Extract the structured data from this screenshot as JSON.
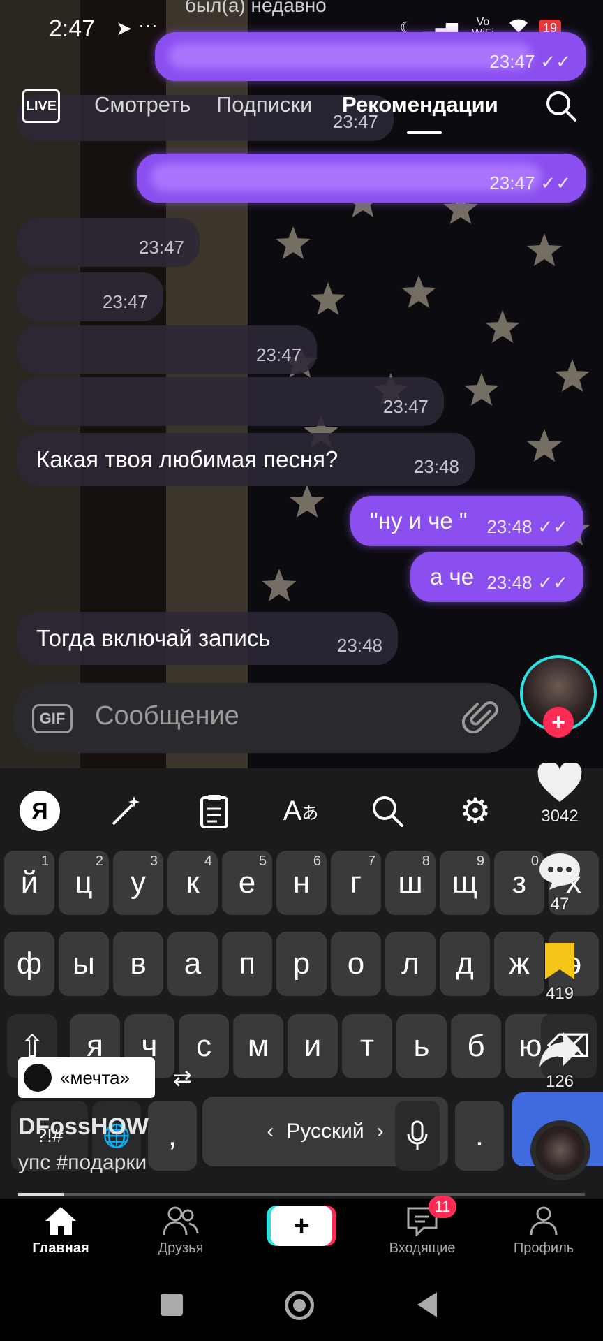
{
  "status_bar": {
    "time": "2:47",
    "top_partial_text": "был(а) недавно",
    "net_label": "Vo WiFi",
    "battery": "19"
  },
  "top_tabs": {
    "live_label": "LIVE",
    "tabs": [
      {
        "label": "Смотреть",
        "active": false
      },
      {
        "label": "Подписки",
        "active": false
      },
      {
        "label": "Рекомендации",
        "active": true
      }
    ]
  },
  "chat": {
    "messages": [
      {
        "direction": "out",
        "text": "",
        "time": "23:47",
        "blurred": true
      },
      {
        "direction": "in",
        "text": "",
        "time": "23:47",
        "blurred": true
      },
      {
        "direction": "out",
        "text": "",
        "time": "23:47",
        "blurred": true
      },
      {
        "direction": "in",
        "text": "",
        "time": "23:47",
        "blurred": true
      },
      {
        "direction": "in",
        "text": "",
        "time": "23:47",
        "blurred": true
      },
      {
        "direction": "in",
        "text": "",
        "time": "23:47",
        "blurred": true
      },
      {
        "direction": "in",
        "text": "",
        "time": "23:47",
        "blurred": true
      },
      {
        "direction": "in",
        "text": "Какая твоя любимая песня?",
        "time": "23:48"
      },
      {
        "direction": "out",
        "text": "\"ну и че \"",
        "time": "23:48"
      },
      {
        "direction": "out",
        "text": "а че",
        "time": "23:48"
      },
      {
        "direction": "in",
        "text": "Тогда включай запись",
        "time": "23:48"
      }
    ],
    "input_placeholder": "Сообщение",
    "gif_label": "GIF"
  },
  "keyboard": {
    "row1": [
      {
        "k": "й",
        "s": "1"
      },
      {
        "k": "ц",
        "s": "2"
      },
      {
        "k": "у",
        "s": "3"
      },
      {
        "k": "к",
        "s": "4"
      },
      {
        "k": "е",
        "s": "5"
      },
      {
        "k": "н",
        "s": "6"
      },
      {
        "k": "г",
        "s": "7"
      },
      {
        "k": "ш",
        "s": "8"
      },
      {
        "k": "щ",
        "s": "9"
      },
      {
        "k": "з",
        "s": "0"
      },
      {
        "k": "х",
        "s": ""
      }
    ],
    "row2": [
      "ф",
      "ы",
      "в",
      "а",
      "п",
      "р",
      "о",
      "л",
      "д",
      "ж",
      "э"
    ],
    "row3": [
      "я",
      "ч",
      "с",
      "м",
      "и",
      "т",
      "ь",
      "б",
      "ю"
    ],
    "comma": ",",
    "period": ".",
    "space_label": "Русский",
    "symbols_label": "?!#"
  },
  "rail": {
    "likes": "3042",
    "comments": "47",
    "saves": "419",
    "shares": "126"
  },
  "video": {
    "sound_label": "«мечта»",
    "caption_line1": "DFossHOW",
    "caption_line2": "упс #подарки",
    "progress": 0.08
  },
  "bottom_nav": {
    "items": [
      {
        "label": "Главная",
        "active": true
      },
      {
        "label": "Друзья",
        "active": false
      },
      {
        "label": "Входящие",
        "active": false
      },
      {
        "label": "Профиль",
        "active": false
      }
    ],
    "inbox_badge": "11",
    "create_label": "+"
  },
  "colors": {
    "accent_purple": "#8b4ff0",
    "tiktok_red": "#fe2c55",
    "tiktok_cyan": "#2fe0e0",
    "save_yellow": "#f5c518"
  }
}
